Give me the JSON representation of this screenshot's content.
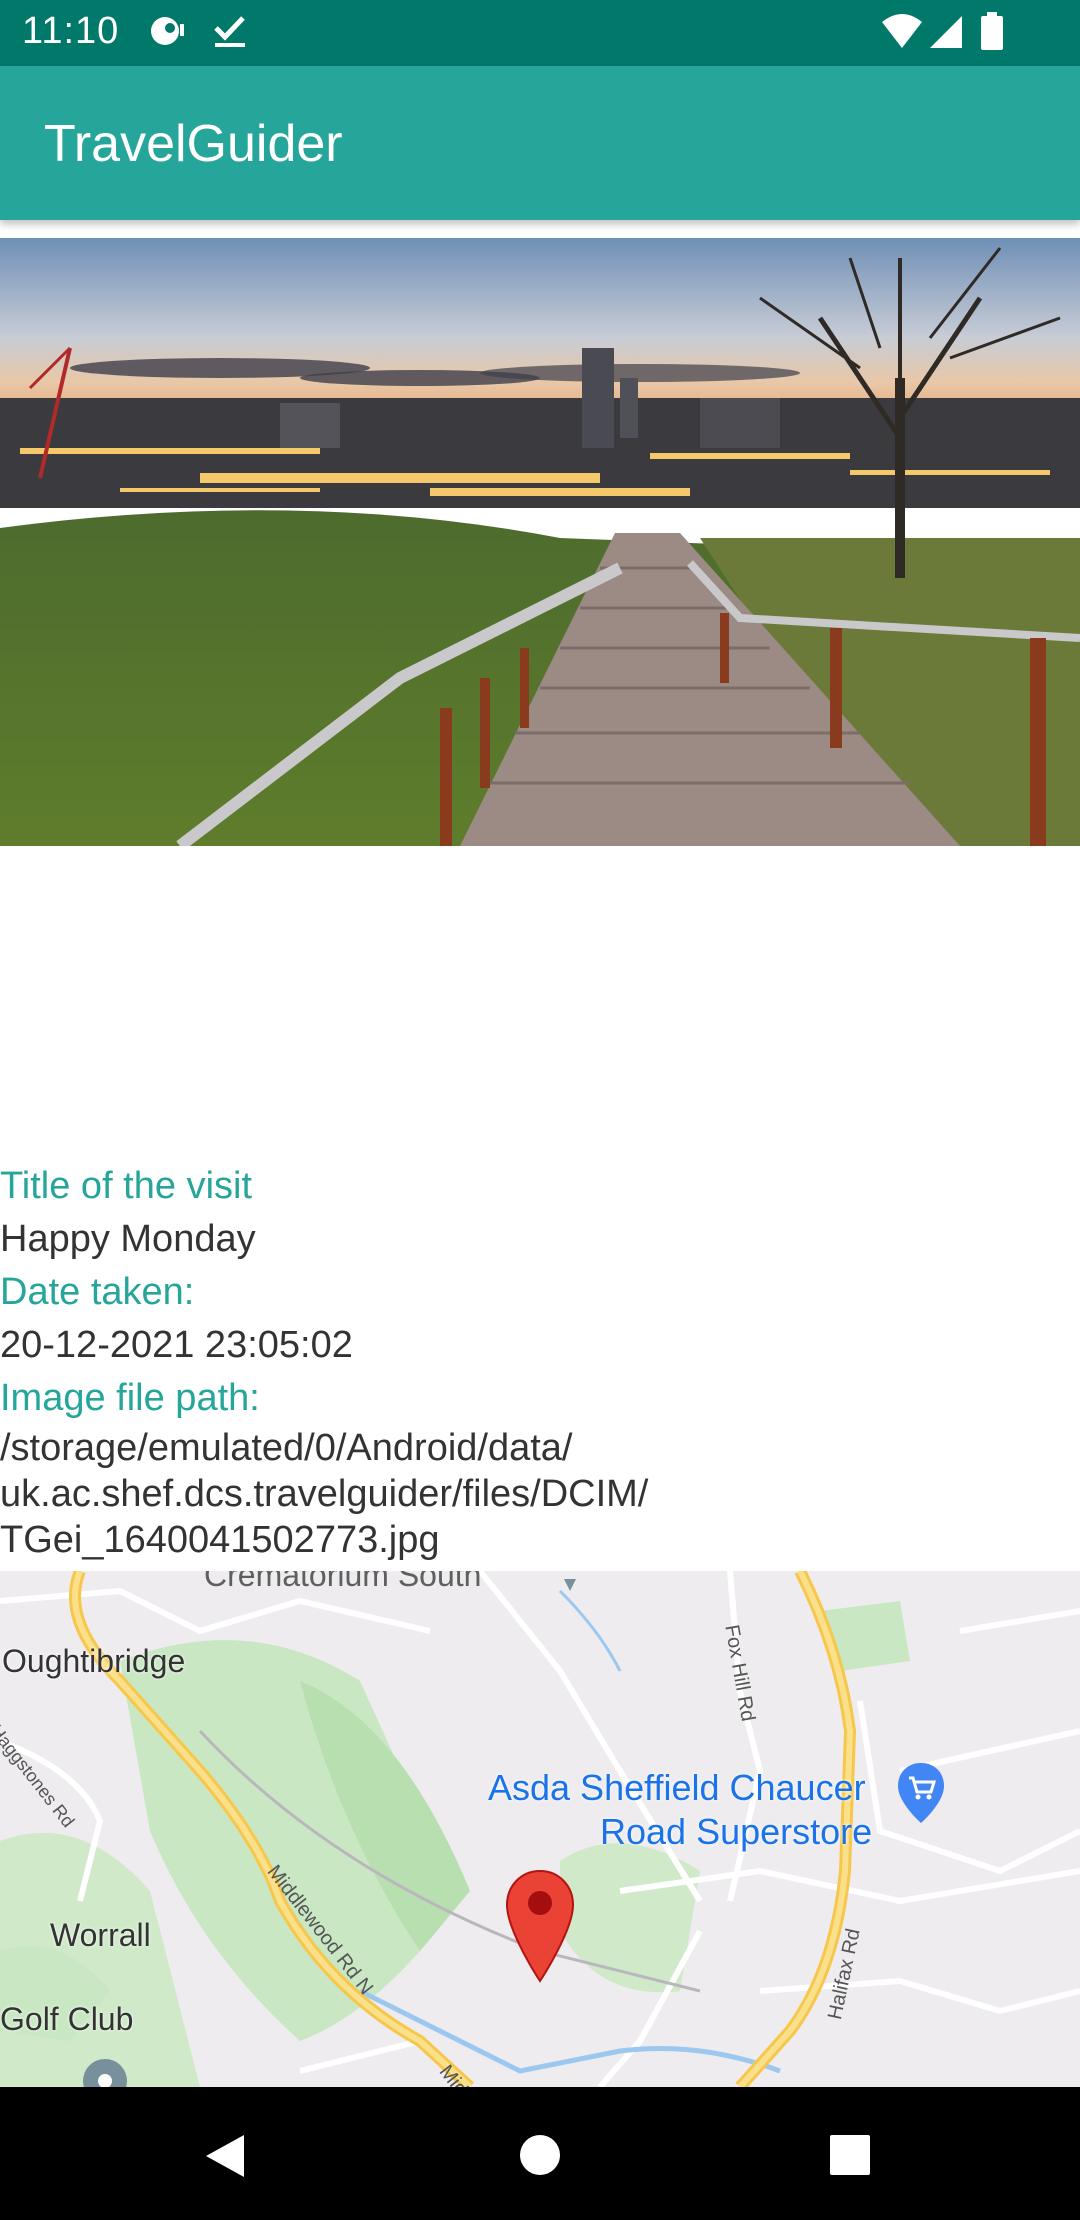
{
  "status_bar": {
    "time": "11:10",
    "icons": [
      "notification-icon",
      "check-icon",
      "wifi-icon",
      "signal-icon",
      "battery-icon"
    ]
  },
  "app_bar": {
    "title": "TravelGuider",
    "color": "#26a69a"
  },
  "photo": {
    "description_icon": "city-skyline-photo"
  },
  "visit": {
    "title_label": "Title of the visit",
    "title_value": "Happy Monday",
    "date_label": "Date taken:",
    "date_value": "20-12-2021 23:05:02",
    "path_label": "Image file path:",
    "path_line1": "/storage/emulated/0/Android/data/",
    "path_line2": "uk.ac.shef.dcs.travelguider/files/DCIM/",
    "path_line3": "TGei_1640041502773.jpg"
  },
  "map": {
    "place_top": "Crematorium South",
    "place_oughtibridge": "Oughtibridge",
    "place_worrall": "Worrall",
    "place_golf": "Golf Club",
    "road_haggstones": "Haggstones Rd",
    "road_middlewood": "Middlewood Rd N",
    "road_middlewood_cut": "Mid",
    "road_foxhill": "Fox Hill Rd",
    "road_halifax": "Halifax Rd",
    "poi_line1": "Asda Sheffield Chaucer",
    "poi_line2": "Road Superstore",
    "poi_color": "#1a73e8",
    "marker_color": "#ea4335"
  },
  "nav_bar": {
    "icons": [
      "back-icon",
      "home-icon",
      "recents-icon"
    ]
  }
}
